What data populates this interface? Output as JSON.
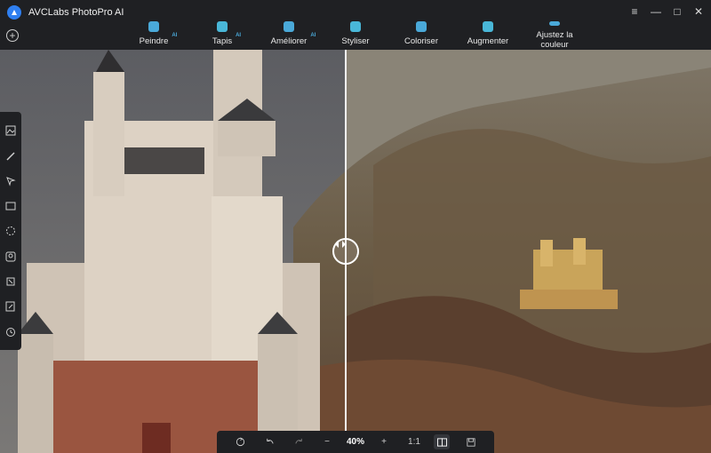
{
  "app": {
    "title": "AVCLabs PhotoPro AI"
  },
  "window_controls": {
    "menu": "≡",
    "minimize": "—",
    "maximize": "□",
    "close": "✕"
  },
  "toolbar": {
    "add_icon": "plus-circle-icon",
    "tools": [
      {
        "label": "Peindre",
        "ai": "AI",
        "icon": "paint-icon"
      },
      {
        "label": "Tapis",
        "ai": "AI",
        "icon": "carpet-icon"
      },
      {
        "label": "Améliorer",
        "ai": "AI",
        "icon": "enhance-icon"
      },
      {
        "label": "Styliser",
        "ai": "",
        "icon": "stylize-icon"
      },
      {
        "label": "Coloriser",
        "ai": "",
        "icon": "colorize-icon"
      },
      {
        "label": "Augmenter",
        "ai": "",
        "icon": "upscale-icon"
      },
      {
        "label": "Ajustez la couleur",
        "ai": "",
        "icon": "adjust-color-icon"
      }
    ]
  },
  "left_rail": {
    "icons": [
      "image-icon",
      "brush-icon",
      "select-arrow-icon",
      "rectangle-select-icon",
      "lasso-icon",
      "portrait-icon",
      "crop-icon",
      "edit-image-icon",
      "history-icon"
    ]
  },
  "bottom_bar": {
    "zoom": "40%",
    "ratio": "1:1",
    "zoom_out": "−",
    "zoom_in": "+"
  },
  "colors": {
    "accent": "#4aa9d9",
    "bg": "#1f2023"
  }
}
